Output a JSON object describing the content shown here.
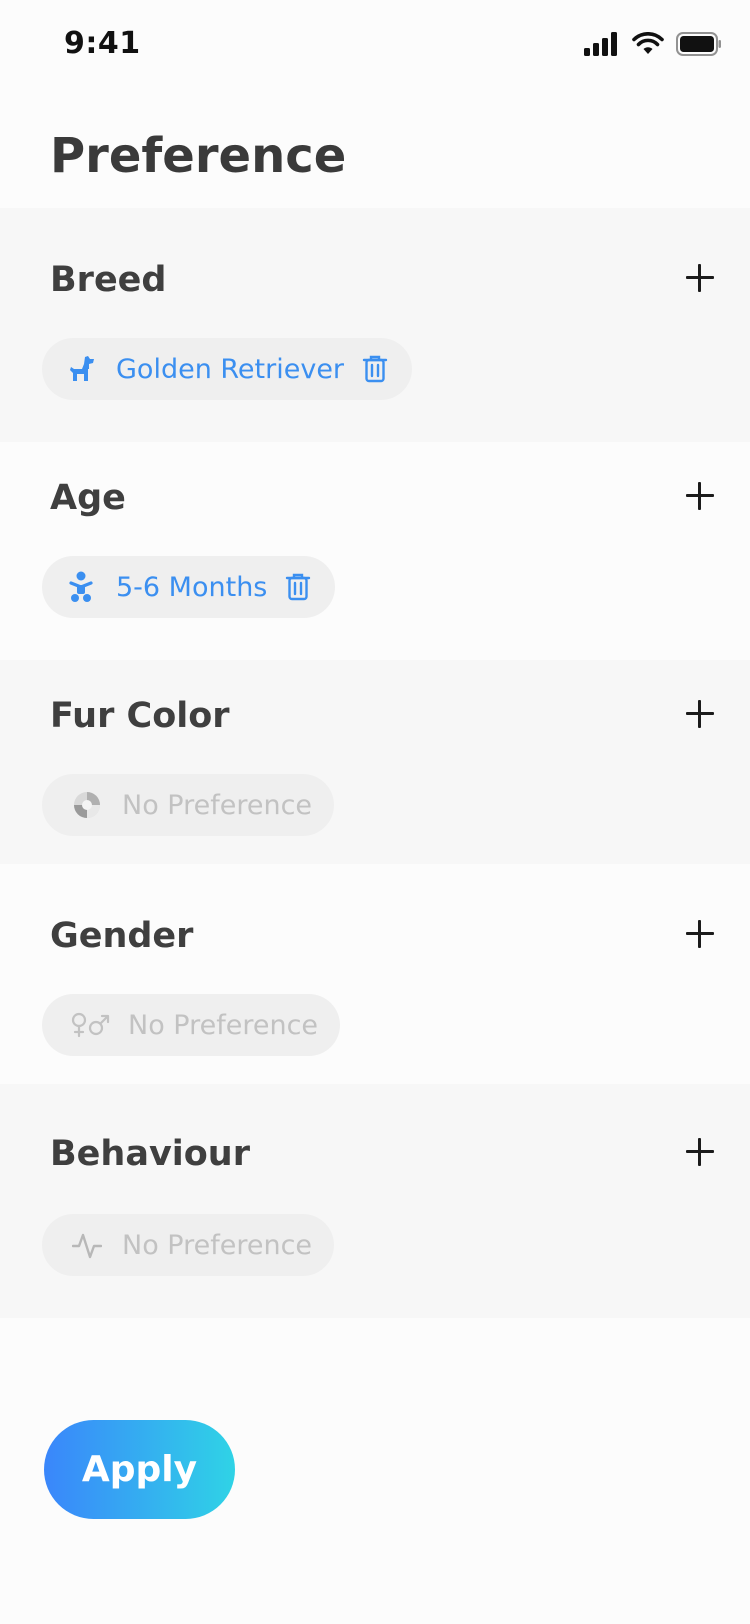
{
  "status_bar": {
    "time": "9:41"
  },
  "page_title": "Preference",
  "sections": [
    {
      "title": "Breed",
      "value": "Golden Retriever",
      "state": "active",
      "icon": "dog-icon"
    },
    {
      "title": "Age",
      "value": "5-6 Months",
      "state": "active",
      "icon": "baby-icon"
    },
    {
      "title": "Fur Color",
      "value": "No Preference",
      "state": "muted",
      "icon": "color-wheel-icon"
    },
    {
      "title": "Gender",
      "value": "No Preference",
      "state": "muted",
      "icon": "gender-icon"
    },
    {
      "title": "Behaviour",
      "value": "No Preference",
      "state": "muted",
      "icon": "activity-icon"
    }
  ],
  "apply_label": "Apply",
  "colors": {
    "accent": "#3b8ff0",
    "gradient_start": "#3a86fb",
    "gradient_end": "#2fd3e6",
    "muted_text": "#c2c2c2"
  }
}
